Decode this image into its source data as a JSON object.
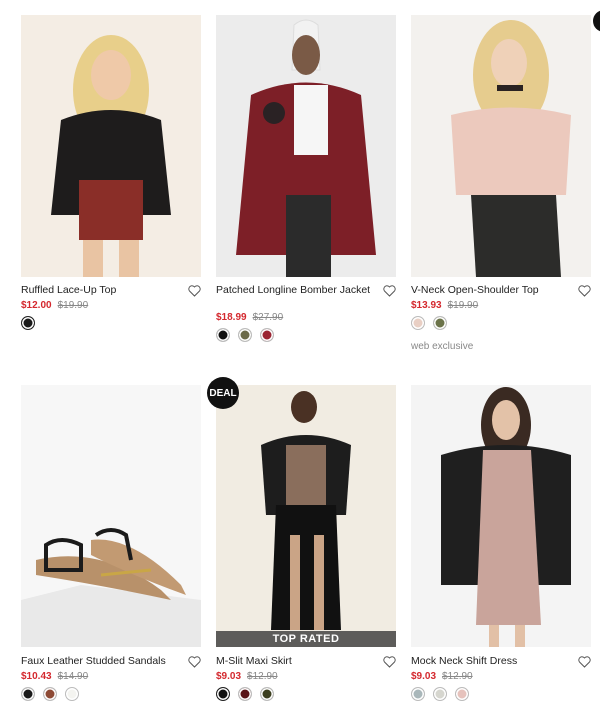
{
  "products": [
    {
      "name": "Ruffled Lace-Up Top",
      "sale_price": "$12.00",
      "original_price": "$19.90",
      "swatches": [
        "#1a1a1a"
      ],
      "selected_swatch": 0
    },
    {
      "name": "Patched Longline Bomber Jacket",
      "sale_price": "$18.99",
      "original_price": "$27.90",
      "swatches": [
        "#111111",
        "#6b6a48",
        "#9b2432"
      ],
      "selected_swatch": -1
    },
    {
      "name": "V-Neck Open-Shoulder Top",
      "sale_price": "$13.93",
      "original_price": "$19.90",
      "swatches": [
        "#e9cfc4",
        "#6b7349"
      ],
      "selected_swatch": -1,
      "note": "web exclusive"
    },
    {
      "name": "Faux Leather Studded Sandals",
      "sale_price": "$10.43",
      "original_price": "$14.90",
      "swatches": [
        "#1a1a1a",
        "#8e4a35",
        "#f4f4f0"
      ],
      "selected_swatch": -1
    },
    {
      "name": "M-Slit Maxi Skirt",
      "sale_price": "$9.03",
      "original_price": "$12.90",
      "swatches": [
        "#111111",
        "#5a1418",
        "#3c3f1f"
      ],
      "selected_swatch": 0,
      "badge": "DEAL",
      "ribbon": "TOP RATED"
    },
    {
      "name": "Mock Neck Shift Dress",
      "sale_price": "$9.03",
      "original_price": "$12.90",
      "swatches": [
        "#a9b7ba",
        "#d6d6cf",
        "#e6c2bc"
      ],
      "selected_swatch": -1
    }
  ],
  "icons": {
    "favorite": "heart-outline-icon",
    "corner": "circle-icon"
  }
}
